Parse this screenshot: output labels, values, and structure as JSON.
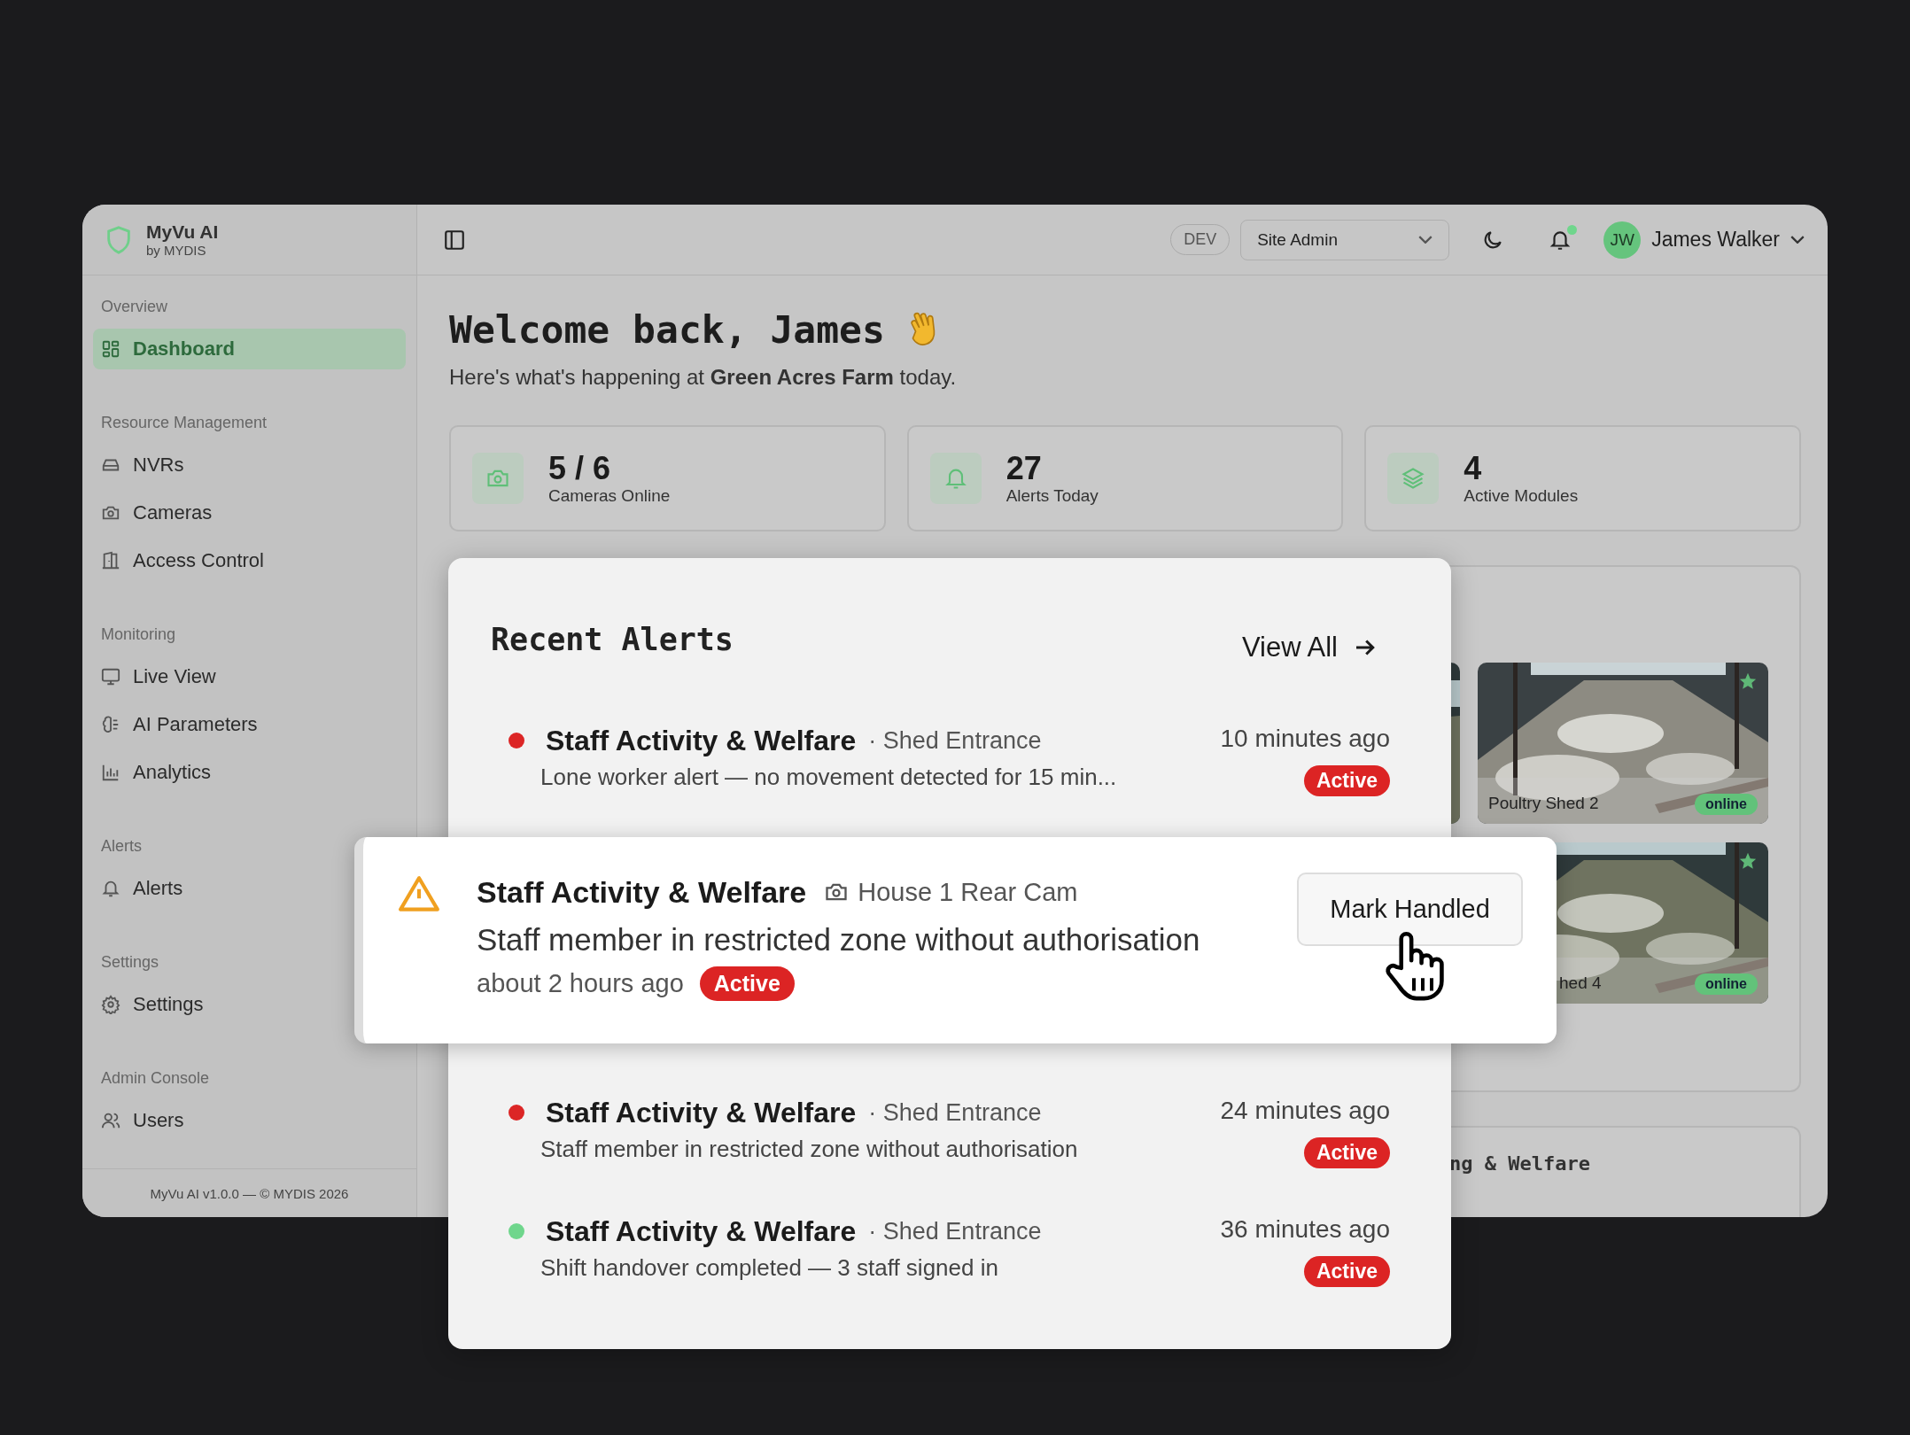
{
  "app": {
    "name": "MyVu AI",
    "by": "by MYDIS"
  },
  "sidebar": {
    "sections": [
      {
        "title": "Overview",
        "items": [
          {
            "label": "Dashboard",
            "selected": true
          }
        ]
      },
      {
        "title": "Resource Management",
        "items": [
          {
            "label": "NVRs",
            "selected": false
          },
          {
            "label": "Cameras",
            "selected": false
          },
          {
            "label": "Access Control",
            "selected": false
          }
        ]
      },
      {
        "title": "Monitoring",
        "items": [
          {
            "label": "Live View",
            "selected": false
          },
          {
            "label": "AI Parameters",
            "selected": false
          },
          {
            "label": "Analytics",
            "selected": false
          }
        ]
      },
      {
        "title": "Alerts",
        "items": [
          {
            "label": "Alerts",
            "selected": false
          }
        ]
      },
      {
        "title": "Settings",
        "items": [
          {
            "label": "Settings",
            "selected": false
          }
        ]
      },
      {
        "title": "Admin Console",
        "items": [
          {
            "label": "Users",
            "selected": false
          }
        ]
      }
    ],
    "footer": "MyVu AI v1.0.0 — © MYDIS 2026"
  },
  "header": {
    "env_badge": "DEV",
    "role_select": "Site Admin",
    "notification_dot": true,
    "user": {
      "initials": "JW",
      "name": "James Walker"
    }
  },
  "welcome": {
    "title": "Welcome back, James",
    "subtitle": "Here's what's happening at **Green Acres Farm** today."
  },
  "stats": [
    {
      "value": "5 / 6",
      "label": "Cameras Online"
    },
    {
      "value": "27",
      "label": "Alerts Today"
    },
    {
      "value": "4",
      "label": "Active Modules"
    }
  ],
  "cameras": [
    {
      "name": "Poultry Shed 2",
      "status": "online",
      "favorite": true
    },
    {
      "name": "hed 4",
      "status": "online",
      "favorite": true
    }
  ],
  "bottom_panel": {
    "title": "ng & Welfare"
  },
  "recent_alerts": {
    "title": "Recent Alerts",
    "view_all": "View All",
    "items": [
      {
        "title": "Staff Activity & Welfare",
        "location": "· Shed Entrance",
        "description": "Lone worker alert — no movement detected for 15 min...",
        "time": "10 minutes ago",
        "status": "Active",
        "color": "#dc2626"
      },
      {
        "title": "Staff Activity & Welfare",
        "location": "· Shed Entrance",
        "description": "Staff member in restricted zone without authorisation",
        "time": "24 minutes ago",
        "status": "Active",
        "color": "#dc2626"
      },
      {
        "title": "Staff Activity & Welfare",
        "location": "· Shed Entrance",
        "description": "Shift handover completed — 3 staff signed in",
        "time": "36 minutes ago",
        "status": "Active",
        "color": "#6fd68c"
      }
    ]
  },
  "highlighted_alert": {
    "title": "Staff Activity & Welfare",
    "camera": "House 1 Rear Cam",
    "description": "Staff member in restricted zone without authorisation",
    "time": "about 2 hours ago",
    "status": "Active",
    "action": "Mark Handled"
  }
}
